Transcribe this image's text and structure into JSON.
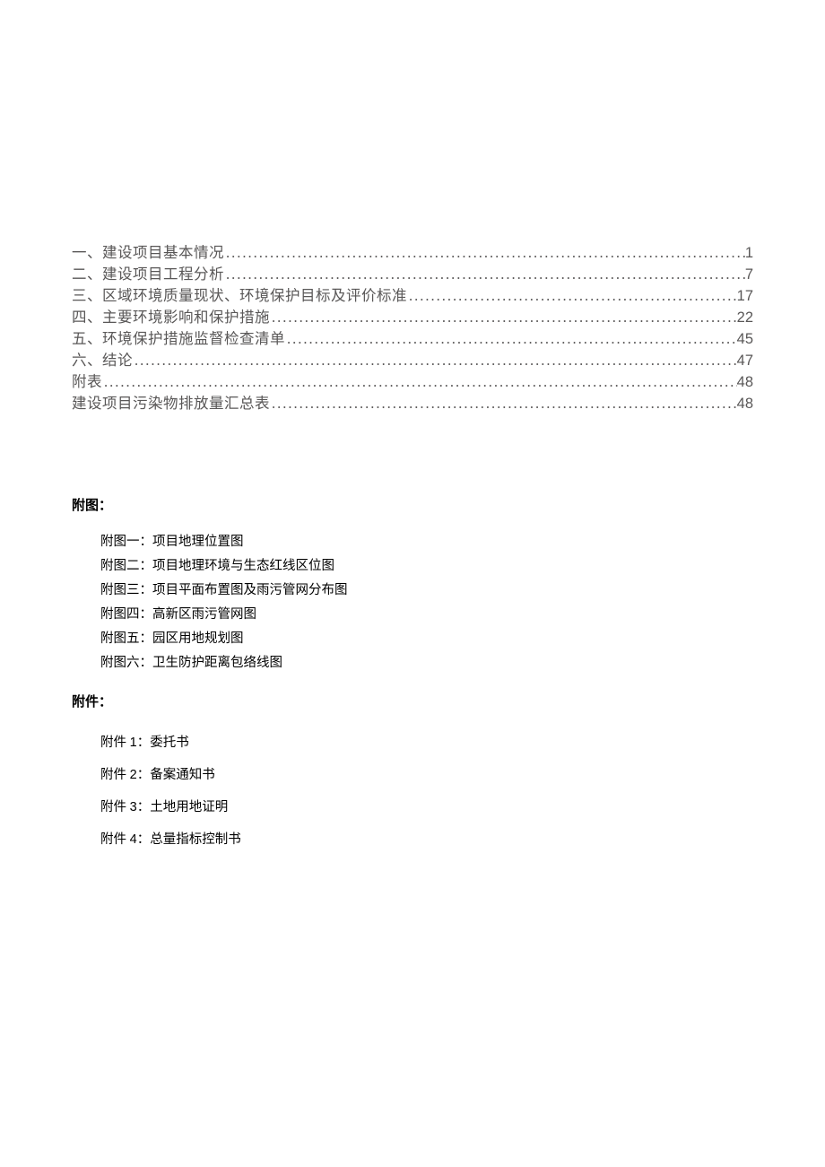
{
  "toc": [
    {
      "label": "一、建设项目基本情况",
      "page": "1"
    },
    {
      "label": "二、建设项目工程分析",
      "page": "7"
    },
    {
      "label": "三、区域环境质量现状、环境保护目标及评价标准",
      "page": "17"
    },
    {
      "label": "四、主要环境影响和保护措施",
      "page": "22"
    },
    {
      "label": "五、环境保护措施监督检查清单",
      "page": "45"
    },
    {
      "label": "六、结论",
      "page": "47"
    },
    {
      "label": "附表",
      "page": "48"
    },
    {
      "label": "建设项目污染物排放量汇总表",
      "page": "48"
    }
  ],
  "appendix_figures": {
    "heading": "附图：",
    "items": [
      "附图一：项目地理位置图",
      "附图二：项目地理环境与生态红线区位图",
      "附图三：项目平面布置图及雨污管网分布图",
      "附图四：高新区雨污管网图",
      "附图五：园区用地规划图",
      "附图六：卫生防护距离包络线图"
    ]
  },
  "attachments": {
    "heading": "附件：",
    "items": [
      {
        "num": "1",
        "label": "：委托书"
      },
      {
        "num": "2",
        "label": "：备案通知书"
      },
      {
        "num": "3",
        "label": "：土地用地证明"
      },
      {
        "num": "4",
        "label": "：总量指标控制书"
      }
    ]
  },
  "attachment_prefix": "附件 "
}
